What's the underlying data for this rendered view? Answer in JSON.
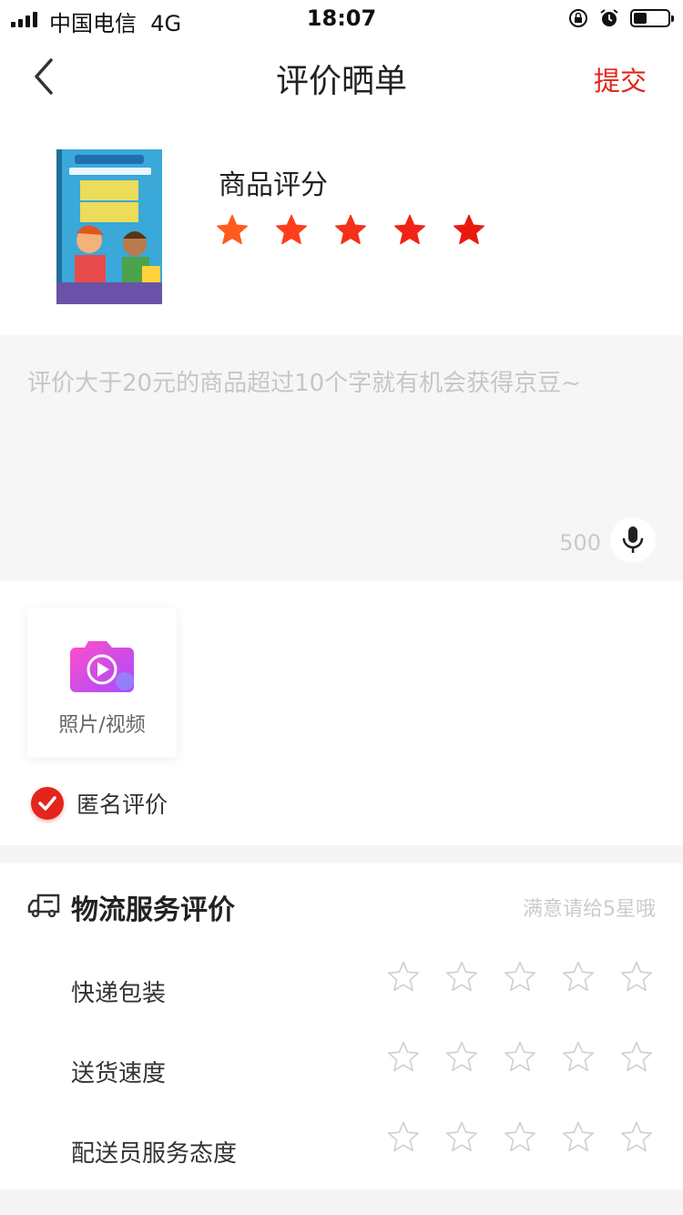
{
  "status_bar": {
    "carrier": "中国电信",
    "network": "4G",
    "time": "18:07"
  },
  "nav": {
    "back_icon": "chevron-left-icon",
    "title": "评价晒单",
    "submit_label": "提交",
    "accent_color": "#e3251d"
  },
  "product": {
    "image_icon": "book-cover-image",
    "rating_label": "商品评分",
    "rating_value": 5,
    "rating_max": 5,
    "star_colors": [
      "#ff5a1f",
      "#ff3c1c",
      "#f53018",
      "#f02414",
      "#e81a10"
    ]
  },
  "comment": {
    "placeholder": "评价大于20元的商品超过10个字就有机会获得京豆~",
    "char_limit": "500",
    "mic_icon": "microphone-icon"
  },
  "media": {
    "upload_label": "照片/视频",
    "upload_icon": "camera-video-icon",
    "anonymous_label": "匿名评价",
    "anonymous_checked": true
  },
  "logistics": {
    "icon": "truck-icon",
    "title": "物流服务评价",
    "hint": "满意请给5星哦",
    "rows": [
      {
        "label": "快递包装",
        "rating": 0,
        "max": 5
      },
      {
        "label": "送货速度",
        "rating": 0,
        "max": 5
      },
      {
        "label": "配送员服务态度",
        "rating": 0,
        "max": 5
      }
    ]
  }
}
